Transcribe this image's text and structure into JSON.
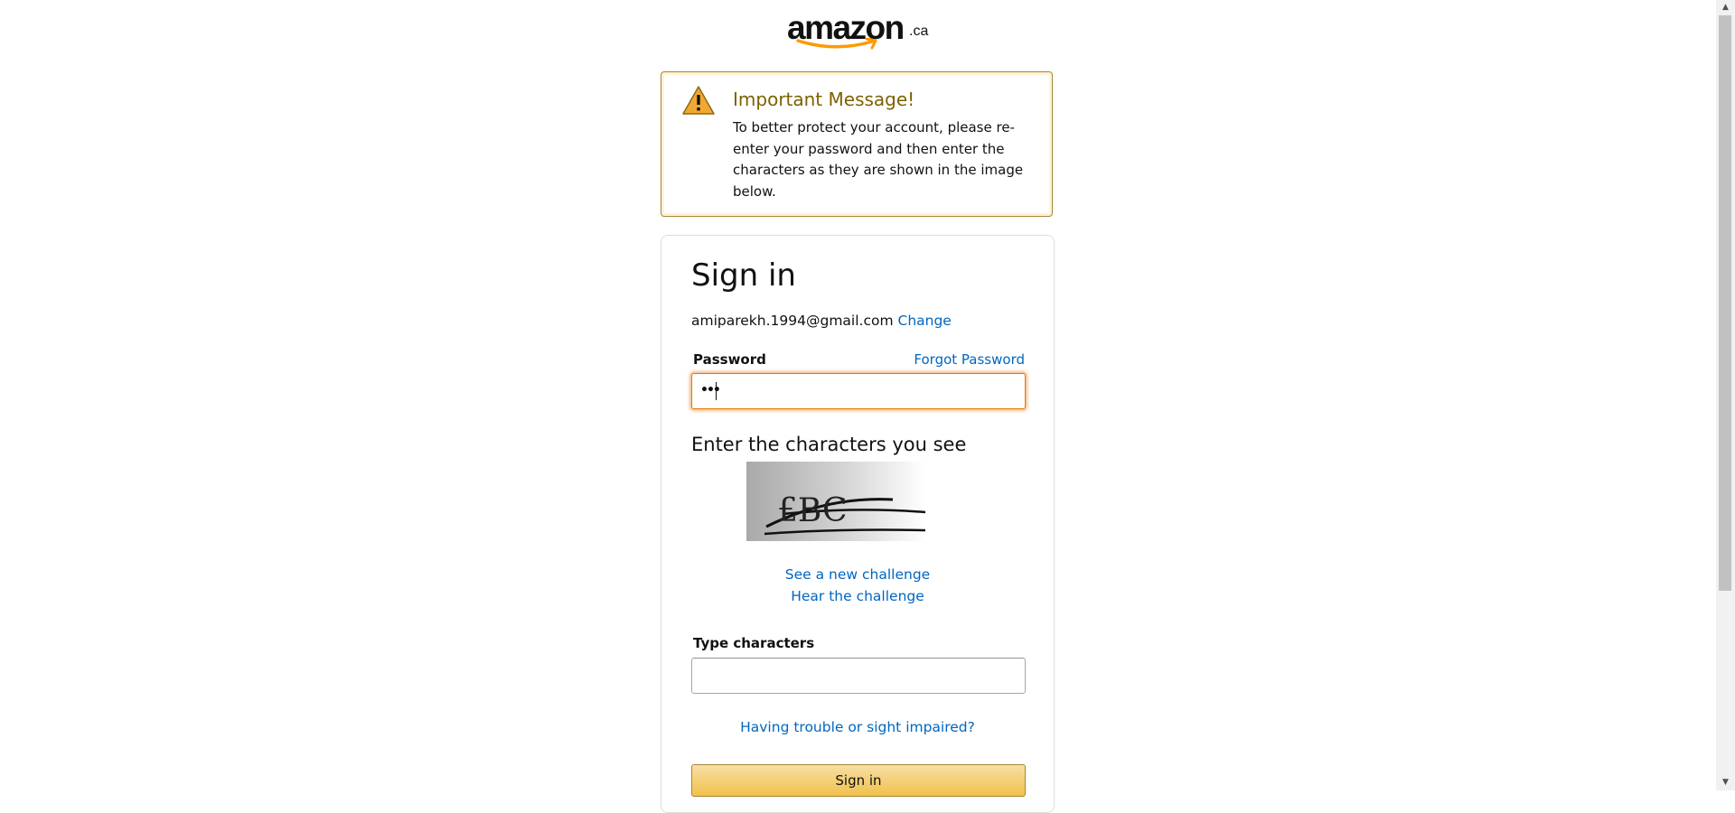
{
  "brand": {
    "logo_text": "amazon",
    "logo_suffix": ".ca"
  },
  "alert": {
    "icon": "warning-icon",
    "heading": "Important Message!",
    "body": "To better protect your account, please re-enter your password and then enter the characters as they are shown in the image below."
  },
  "signin": {
    "title": "Sign in",
    "email": "amiparekh.1994@gmail.com",
    "change_link": "Change",
    "password_label": "Password",
    "forgot_link": "Forgot Password",
    "password_value": "•••",
    "captcha_heading": "Enter the characters you see",
    "captcha_text": "£BC",
    "new_challenge_link": "See a new challenge",
    "hear_challenge_link": "Hear the challenge",
    "type_label": "Type characters",
    "type_value": "",
    "trouble_link": "Having trouble or sight impaired?",
    "button_label": "Sign in"
  },
  "colors": {
    "link": "#0066c0",
    "alert_border": "#a88734",
    "alert_heading": "#7c6200",
    "focus": "#e77600",
    "button_top": "#f7dfa5",
    "button_bottom": "#f0c14b"
  }
}
